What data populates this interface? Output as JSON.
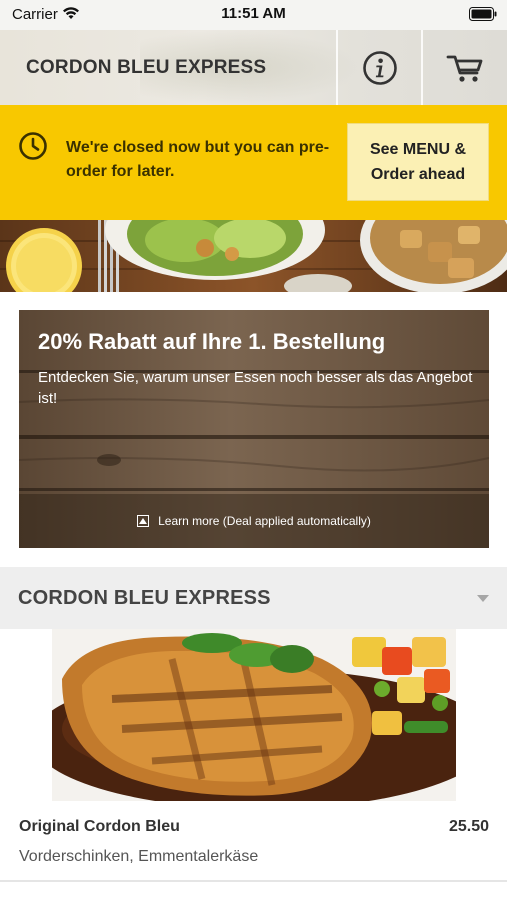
{
  "status_bar": {
    "carrier": "Carrier",
    "time": "11:51 AM",
    "icons": [
      "wifi-icon",
      "battery-icon"
    ]
  },
  "header": {
    "title": "CORDON BLEU EXPRESS",
    "icons": [
      "info-icon",
      "cart-icon"
    ]
  },
  "closed_banner": {
    "message": "We're closed now but you can pre-order for later.",
    "button_label_line1": "See MENU &",
    "button_label_line2": "Order ahead",
    "icon": "clock-icon",
    "background_color": "#f8c800"
  },
  "promo": {
    "title": "20% Rabatt auf Ihre 1. Bestellung",
    "subtitle": "Entdecken Sie, warum unser Essen noch besser als das Angebot ist!",
    "learn_more": "Learn more (Deal applied automatically)"
  },
  "category": {
    "title": "CORDON BLEU EXPRESS",
    "icon": "caret-down-icon"
  },
  "menu_items": [
    {
      "name": "Original Cordon Bleu",
      "price": "25.50",
      "description": "Vorderschinken, Emmentalerkäse"
    }
  ]
}
